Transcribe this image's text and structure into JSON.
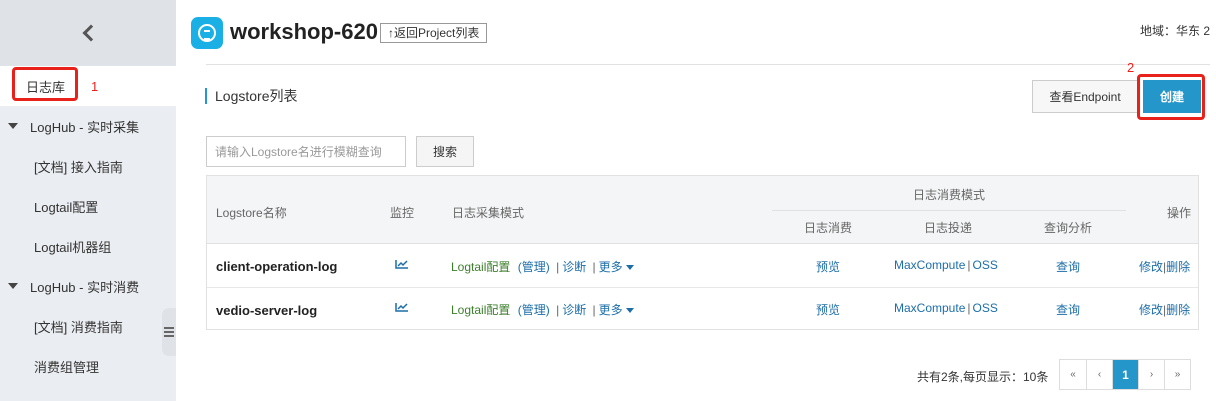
{
  "sidebar": {
    "back_icon": "chevron-left-icon",
    "items": [
      {
        "label": "日志库"
      },
      {
        "label": "LogHub - 实时采集"
      },
      {
        "label": "[文档] 接入指南"
      },
      {
        "label": "Logtail配置"
      },
      {
        "label": "Logtail机器组"
      },
      {
        "label": "LogHub - 实时消费"
      },
      {
        "label": "[文档] 消费指南"
      },
      {
        "label": "消费组管理"
      }
    ],
    "annotation_1": "1"
  },
  "header": {
    "project_name": "workshop-620",
    "back_label": "↑返回Project列表",
    "region": "地域：华东 2"
  },
  "main": {
    "section_title": "Logstore列表",
    "endpoint_button": "查看Endpoint",
    "create_button": "创建",
    "annotation_2": "2",
    "search_placeholder": "请输入Logstore名进行模糊查询",
    "search_button": "搜索"
  },
  "table": {
    "headers": {
      "name": "Logstore名称",
      "monitor": "监控",
      "collect_mode": "日志采集模式",
      "consume_mode": "日志消费模式",
      "consume": "日志消费",
      "ship": "日志投递",
      "query": "查询分析",
      "action": "操作"
    },
    "rows": [
      {
        "name": "client-operation-log",
        "logtail": "Logtail配置",
        "manage": "(管理)",
        "diagnose": "诊断",
        "more": "更多",
        "preview": "预览",
        "maxcompute": "MaxCompute",
        "oss": "OSS",
        "query": "查询",
        "edit": "修改",
        "delete": "删除"
      },
      {
        "name": "vedio-server-log",
        "logtail": "Logtail配置",
        "manage": "(管理)",
        "diagnose": "诊断",
        "more": "更多",
        "preview": "预览",
        "maxcompute": "MaxCompute",
        "oss": "OSS",
        "query": "查询",
        "edit": "修改",
        "delete": "删除"
      }
    ]
  },
  "pagination": {
    "info": "共有2条,每页显示：10条",
    "first": "«",
    "prev": "‹",
    "current": "1",
    "next": "›",
    "last": "»"
  },
  "colors": {
    "accent": "#2596c9",
    "annotation_red": "#e8221b",
    "link": "#1c6ea9"
  }
}
